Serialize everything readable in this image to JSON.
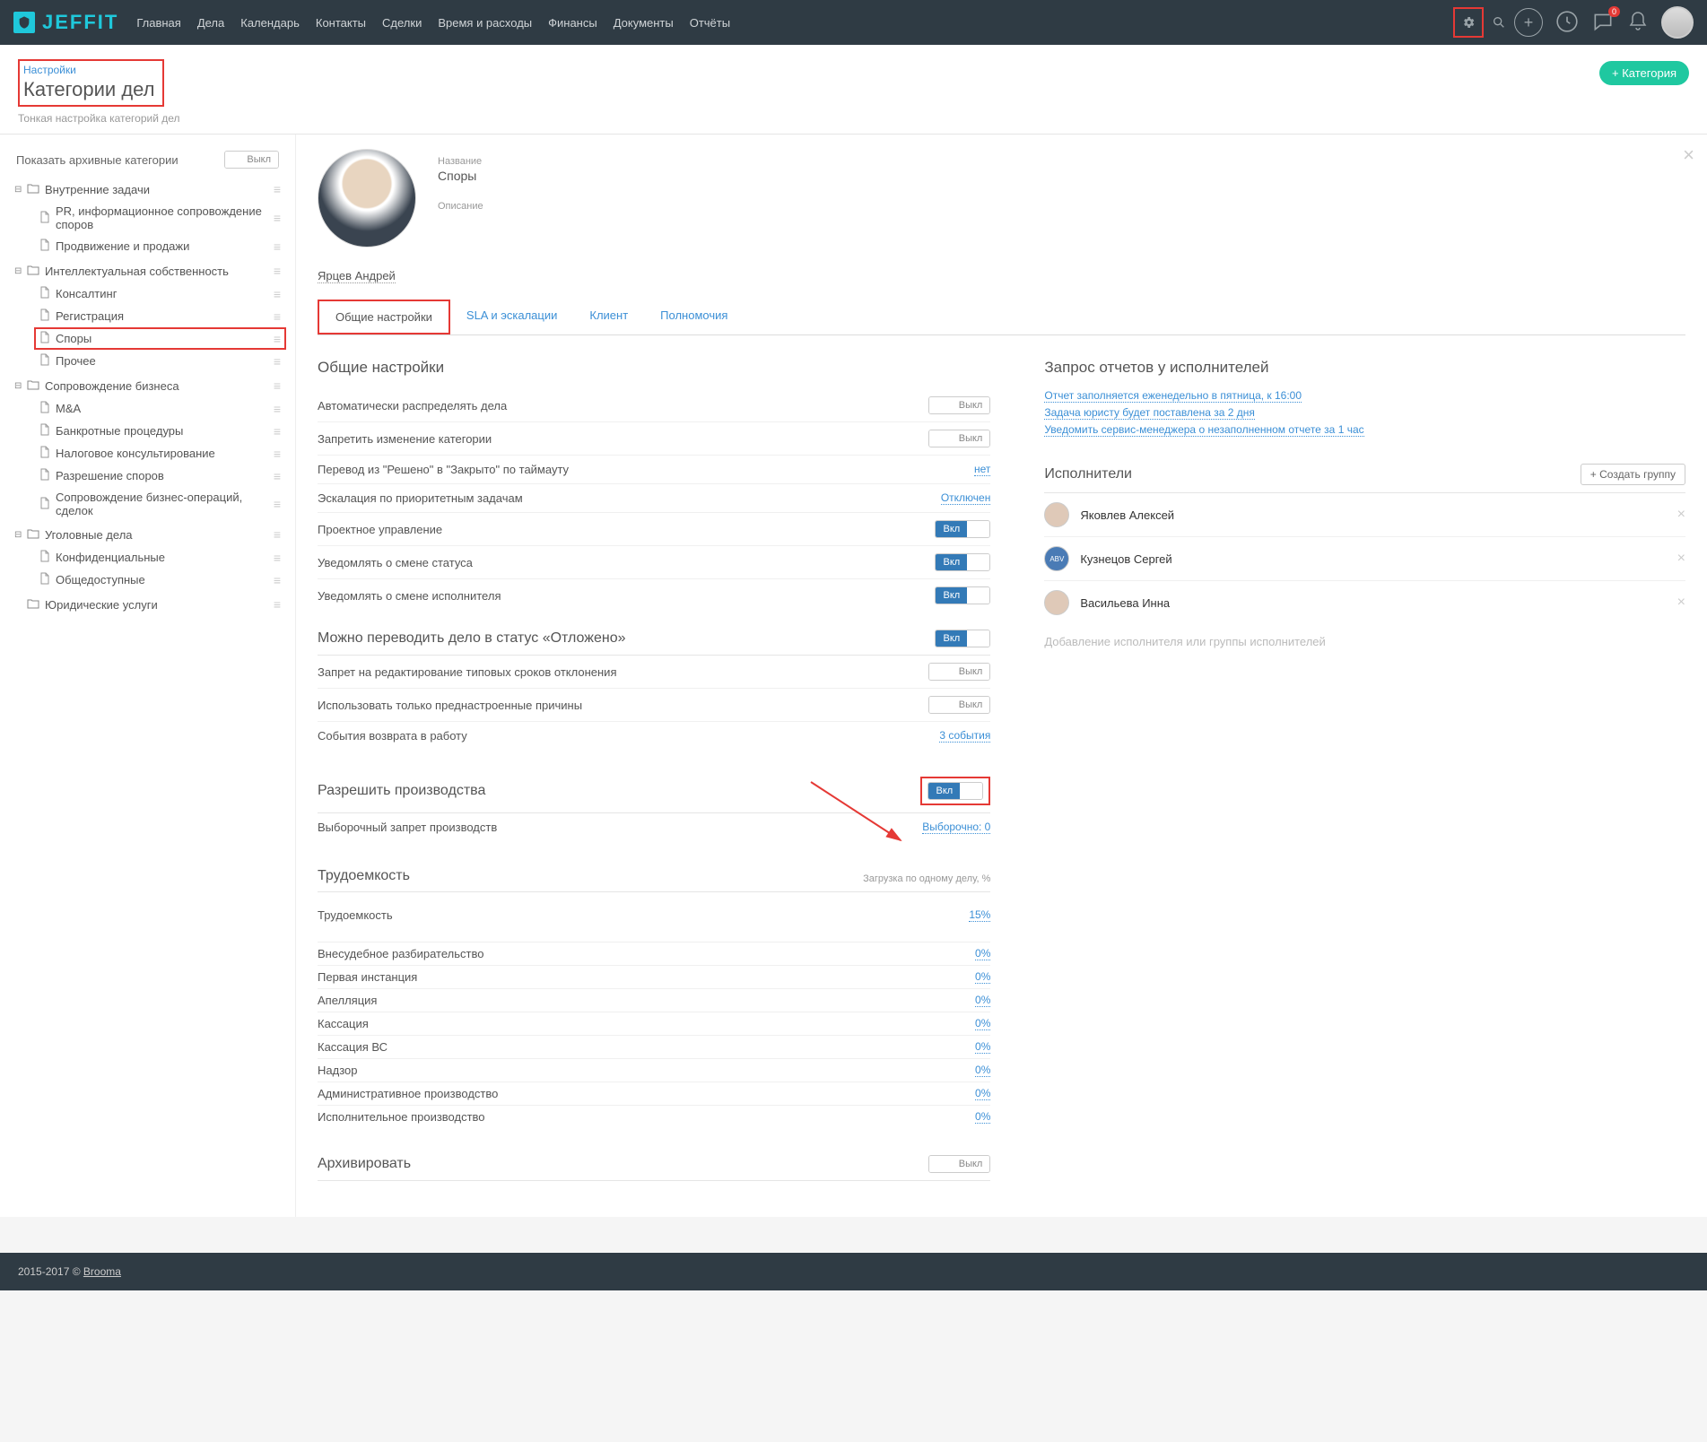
{
  "brand": "JEFFIT",
  "nav": [
    "Главная",
    "Дела",
    "Календарь",
    "Контакты",
    "Сделки",
    "Время и расходы",
    "Финансы",
    "Документы",
    "Отчёты"
  ],
  "chat_badge": "0",
  "breadcrumb": "Настройки",
  "page_title": "Категории дел",
  "page_subtitle": "Тонкая настройка категорий дел",
  "btn_add_category": "+ Категория",
  "sidebar": {
    "archive_label": "Показать архивные категории",
    "archive_toggle": "Выкл",
    "groups": [
      {
        "name": "Внутренние задачи",
        "items": [
          "PR, информационное сопровождение споров",
          "Продвижение и продажи"
        ]
      },
      {
        "name": "Интеллектуальная собственность",
        "items": [
          "Консалтинг",
          "Регистрация",
          "Споры",
          "Прочее"
        ],
        "selected": "Споры"
      },
      {
        "name": "Сопровождение бизнеса",
        "items": [
          "M&A",
          "Банкротные процедуры",
          "Налоговое консультирование",
          "Разрешение споров",
          "Сопровождение бизнес-операций, сделок"
        ]
      },
      {
        "name": "Уголовные дела",
        "items": [
          "Конфиденциальные",
          "Общедоступные"
        ]
      },
      {
        "name": "Юридические услуги",
        "items": []
      }
    ]
  },
  "profile": {
    "name_label": "Название",
    "name_value": "Споры",
    "desc_label": "Описание",
    "owner": "Ярцев Андрей"
  },
  "tabs": [
    "Общие настройки",
    "SLA и эскалации",
    "Клиент",
    "Полномочия"
  ],
  "sections": {
    "general": "Общие настройки",
    "general_rows": [
      {
        "label": "Автоматически распределять дела",
        "toggle": "Выкл"
      },
      {
        "label": "Запретить изменение категории",
        "toggle": "Выкл"
      },
      {
        "label": "Перевод из \"Решено\" в \"Закрыто\" по таймауту",
        "link": "нет"
      },
      {
        "label": "Эскалация по приоритетным задачам",
        "link": "Отключен"
      },
      {
        "label": "Проектное управление",
        "toggle": "Вкл"
      },
      {
        "label": "Уведомлять о смене статуса",
        "toggle": "Вкл"
      },
      {
        "label": "Уведомлять о смене исполнителя",
        "toggle": "Вкл"
      }
    ],
    "postpone_title": "Можно переводить дело в статус «Отложено»",
    "postpone_toggle": "Вкл",
    "postpone_rows": [
      {
        "label": "Запрет на редактирование типовых сроков отклонения",
        "toggle": "Выкл"
      },
      {
        "label": "Использовать только преднастроенные причины",
        "toggle": "Выкл"
      },
      {
        "label": "События возврата в работу",
        "link": "3 события"
      }
    ],
    "allow_prod_title": "Разрешить производства",
    "allow_prod_toggle": "Вкл",
    "allow_prod_rows": [
      {
        "label": "Выборочный запрет производств",
        "link": "Выборочно: 0"
      }
    ],
    "labor_title": "Трудоемкость",
    "labor_sub": "Загрузка по одному делу, %",
    "labor_rows": [
      {
        "label": "Трудоемкость",
        "link": "15%"
      },
      {
        "label": "Внесудебное разбирательство",
        "link": "0%"
      },
      {
        "label": "Первая инстанция",
        "link": "0%"
      },
      {
        "label": "Апелляция",
        "link": "0%"
      },
      {
        "label": "Кассация",
        "link": "0%"
      },
      {
        "label": "Кассация ВС",
        "link": "0%"
      },
      {
        "label": "Надзор",
        "link": "0%"
      },
      {
        "label": "Административное производство",
        "link": "0%"
      },
      {
        "label": "Исполнительное производство",
        "link": "0%"
      }
    ],
    "archive_title": "Архивировать",
    "archive_toggle": "Выкл"
  },
  "reports": {
    "title": "Запрос отчетов у исполнителей",
    "links": [
      "Отчет заполняется еженедельно в пятница, к 16:00",
      "Задача юристу будет поставлена за 2 дня",
      "Уведомить сервис-менеджера о незаполненном отчете за 1 час"
    ]
  },
  "executors": {
    "title": "Исполнители",
    "create_group": "+ Создать группу",
    "list": [
      "Яковлев Алексей",
      "Кузнецов Сергей",
      "Васильева Инна"
    ],
    "add_placeholder": "Добавление исполнителя или группы исполнителей"
  },
  "footer": {
    "copy": "2015-2017 © ",
    "brand": "Brooma"
  }
}
